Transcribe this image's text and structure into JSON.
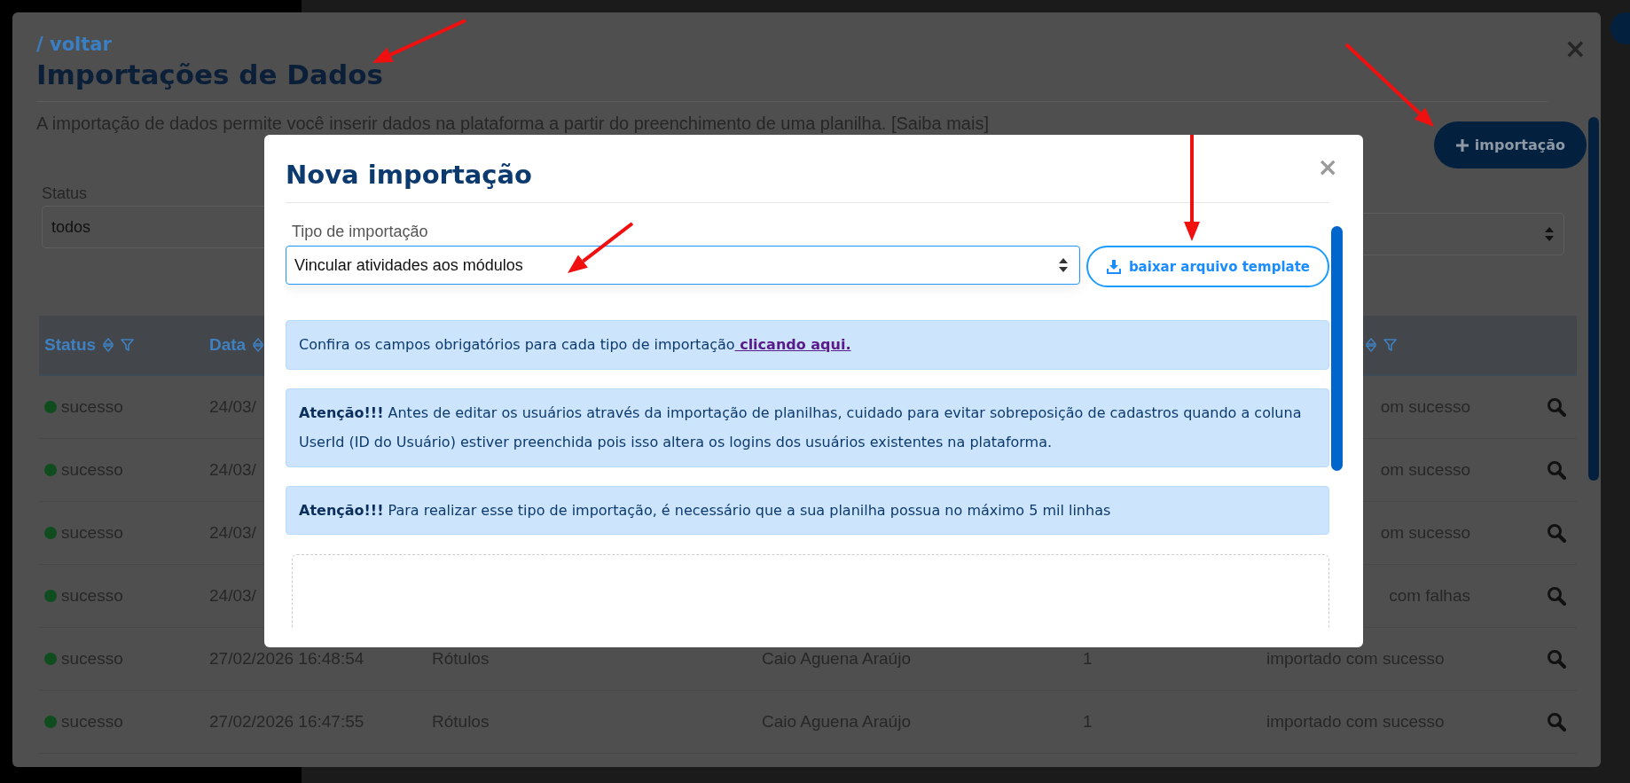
{
  "page": {
    "back_link": "/ voltar",
    "title": "Importações de Dados",
    "description": "A importação de dados permite você inserir dados na plataforma a partir do preenchimento de uma planilha. [Saiba mais]",
    "new_button": "importação",
    "close": "×"
  },
  "filters": [
    {
      "label": "Status",
      "value": "todos"
    }
  ],
  "table": {
    "columns": [
      {
        "label": "Status",
        "filter": true
      },
      {
        "label": "Data",
        "filter": false
      }
    ],
    "rows": [
      {
        "status": "sucesso",
        "color": "#0f4d1f",
        "date": "24/03/",
        "result": "om sucesso",
        "covered": true
      },
      {
        "status": "sucesso",
        "color": "#0f4d1f",
        "date": "24/03/",
        "result": "om sucesso",
        "covered": true
      },
      {
        "status": "sucesso",
        "color": "#0f4d1f",
        "date": "24/03/",
        "result": "om sucesso",
        "covered": true
      },
      {
        "status": "sucesso",
        "color": "#0f4d1f",
        "date": "24/03/",
        "result": "com falhas",
        "covered": true
      },
      {
        "status": "sucesso",
        "color": "#0f4d1f",
        "date": "27/02/2026 16:48:54",
        "type": "Rótulos",
        "user": "Caio Aguena Araújo",
        "count": "1",
        "result": "importado com sucesso",
        "covered": false
      },
      {
        "status": "sucesso",
        "color": "#0f4d1f",
        "date": "27/02/2026 16:47:55",
        "type": "Rótulos",
        "user": "Caio Aguena Araújo",
        "count": "1",
        "result": "importado com sucesso",
        "covered": false
      }
    ]
  },
  "modal": {
    "title": "Nova importação",
    "close": "×",
    "type_label": "Tipo de importação",
    "type_value": "Vincular atividades aos módulos",
    "template_button": "baixar arquivo template",
    "alerts": [
      {
        "text": "Confira os campos obrigatórios para cada tipo de importação",
        "link": " clicando aqui."
      },
      {
        "strong": "Atenção!!!",
        "text": " Antes de editar os usuários através da importação de planilhas, cuidado para evitar sobreposição de cadastros quando a coluna UserId (ID do Usuário) estiver preenchida pois isso altera os logins dos usuários existentes na plataforma."
      },
      {
        "strong": "Atenção!!!",
        "text": " Para realizar esse tipo de importação, é necessário que a sua planilha possua no máximo 5 mil linhas"
      }
    ]
  }
}
